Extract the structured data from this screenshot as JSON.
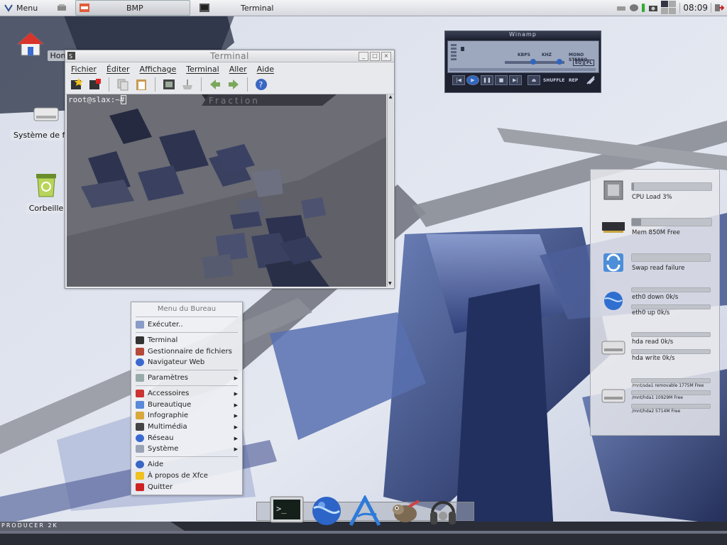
{
  "top_panel": {
    "menu_label": "Menu",
    "tasks": [
      {
        "label": "BMP"
      },
      {
        "label": "Terminal"
      }
    ],
    "clock": "08:09"
  },
  "desktop_icons": {
    "home": "Home",
    "filesystem": "Système de fichi…",
    "trash": "Corbeille"
  },
  "terminal": {
    "title": "Terminal",
    "menu": [
      "Fichier",
      "Éditer",
      "Affichage",
      "Terminal",
      "Aller",
      "Aide"
    ],
    "prompt": "root@slax:~# ",
    "watermark": "Fraction"
  },
  "winamp": {
    "title": "Winamp",
    "kbps_label": "KBPS",
    "khz_label": "KHZ",
    "mode_label": "MONO STEREO",
    "eq_label": "EQ",
    "pl_label": "PL",
    "shuffle_label": "SHUFFLE",
    "repeat_label": "REP"
  },
  "sysmon": {
    "items": [
      {
        "label": "CPU Load 3%",
        "fill": 0.03
      },
      {
        "label": "Mem 850M Free",
        "fill": 0.12
      },
      {
        "label": "Swap read failure",
        "fill": 0.0
      },
      {
        "label": "eth0 down 0k/s",
        "fill": 0.0
      },
      {
        "label": "eth0 up 0k/s",
        "fill": 0.0
      },
      {
        "label": "hda read 0k/s",
        "fill": 0.0
      },
      {
        "label": "hda write 0k/s",
        "fill": 0.0
      },
      {
        "label": "/mnt/sda1 removable 1775M Free",
        "fill": 0.0
      },
      {
        "label": "/mnt/hda1 10929M Free",
        "fill": 0.0
      },
      {
        "label": "/mnt/hda2 5714M Free",
        "fill": 0.0
      }
    ]
  },
  "desk_menu": {
    "title": "Menu du Bureau",
    "items": [
      {
        "label": "Exécuter..",
        "submenu": false
      },
      {
        "label": "Terminal",
        "submenu": false
      },
      {
        "label": "Gestionnaire de fichiers",
        "submenu": false
      },
      {
        "label": "Navigateur Web",
        "submenu": false
      },
      {
        "label": "Paramètres",
        "submenu": true
      },
      {
        "label": "Accessoires",
        "submenu": true
      },
      {
        "label": "Bureautique",
        "submenu": true
      },
      {
        "label": "Infographie",
        "submenu": true
      },
      {
        "label": "Multimédia",
        "submenu": true
      },
      {
        "label": "Réseau",
        "submenu": true
      },
      {
        "label": "Système",
        "submenu": true
      },
      {
        "label": "Aide",
        "submenu": false
      },
      {
        "label": "À propos de Xfce",
        "submenu": false
      },
      {
        "label": "Quitter",
        "submenu": false
      }
    ]
  },
  "dock": [
    "terminal-icon",
    "web-browser-icon",
    "editor-icon",
    "gimp-icon",
    "audio-player-icon"
  ],
  "wallpaper_text": "PRODUCER 2K",
  "colors": {
    "accent": "#3a5fa6",
    "panel": "#d6d8de",
    "wallpaper_dark": "#1f2b56"
  }
}
